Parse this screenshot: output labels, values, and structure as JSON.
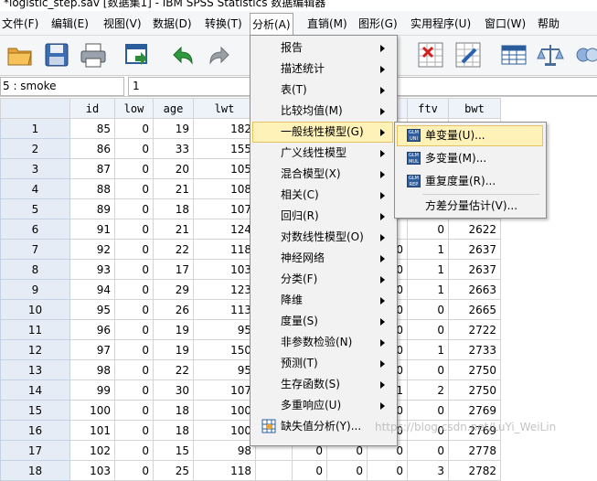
{
  "window": {
    "title": "*logistic_step.sav [数据集1] - IBM SPSS Statistics 数据编辑器"
  },
  "menubar": {
    "items": [
      {
        "label": "文件(F)"
      },
      {
        "label": "编辑(E)"
      },
      {
        "label": "视图(V)"
      },
      {
        "label": "数据(D)"
      },
      {
        "label": "转换(T)"
      },
      {
        "label": "分析(A)"
      },
      {
        "label": "直销(M)"
      },
      {
        "label": "图形(G)"
      },
      {
        "label": "实用程序(U)"
      },
      {
        "label": "窗口(W)"
      },
      {
        "label": "帮助"
      }
    ],
    "active_index": 5
  },
  "toolbar": {
    "icons": [
      "open-folder-icon",
      "save-icon",
      "print-icon",
      "dialog-recall-icon",
      "undo-icon",
      "redo-icon",
      "split-file-icon",
      "select-cases-icon",
      "value-labels-icon",
      "weight-cases-icon"
    ]
  },
  "cell_editor": {
    "reference": "5 : smoke",
    "value": "1"
  },
  "grid": {
    "columns": [
      "id",
      "low",
      "age",
      "lwt",
      "",
      "",
      "ht",
      "ui",
      "ftv",
      "bwt"
    ],
    "rows": [
      {
        "n": "1",
        "cells": [
          "85",
          "0",
          "19",
          "182",
          "",
          "",
          "",
          "",
          "",
          "2523"
        ]
      },
      {
        "n": "2",
        "cells": [
          "86",
          "0",
          "33",
          "155",
          "",
          "",
          "",
          "",
          "",
          "2551"
        ]
      },
      {
        "n": "3",
        "cells": [
          "87",
          "0",
          "20",
          "105",
          "",
          "",
          "",
          "",
          "",
          "2557"
        ]
      },
      {
        "n": "4",
        "cells": [
          "88",
          "0",
          "21",
          "108",
          "",
          "",
          "",
          "",
          "",
          "2594"
        ]
      },
      {
        "n": "5",
        "cells": [
          "89",
          "0",
          "18",
          "107",
          "",
          "",
          "",
          "",
          "",
          "2600"
        ]
      },
      {
        "n": "6",
        "cells": [
          "91",
          "0",
          "21",
          "124",
          "",
          "",
          "",
          "",
          "0",
          "2622"
        ]
      },
      {
        "n": "7",
        "cells": [
          "92",
          "0",
          "22",
          "118",
          "",
          "0",
          "0",
          "0",
          "1",
          "2637"
        ]
      },
      {
        "n": "8",
        "cells": [
          "93",
          "0",
          "17",
          "103",
          "",
          "0",
          "0",
          "0",
          "1",
          "2637"
        ]
      },
      {
        "n": "9",
        "cells": [
          "94",
          "0",
          "29",
          "123",
          "",
          "0",
          "0",
          "0",
          "1",
          "2663"
        ]
      },
      {
        "n": "10",
        "cells": [
          "95",
          "0",
          "26",
          "113",
          "",
          "0",
          "0",
          "0",
          "0",
          "2665"
        ]
      },
      {
        "n": "11",
        "cells": [
          "96",
          "0",
          "19",
          "95",
          "",
          "0",
          "0",
          "0",
          "0",
          "2722"
        ]
      },
      {
        "n": "12",
        "cells": [
          "97",
          "0",
          "19",
          "150",
          "",
          "0",
          "0",
          "0",
          "1",
          "2733"
        ]
      },
      {
        "n": "13",
        "cells": [
          "98",
          "0",
          "22",
          "95",
          "",
          "0",
          "1",
          "0",
          "0",
          "2750"
        ]
      },
      {
        "n": "14",
        "cells": [
          "99",
          "0",
          "30",
          "107",
          "",
          "1",
          "0",
          "1",
          "2",
          "2750"
        ]
      },
      {
        "n": "15",
        "cells": [
          "100",
          "0",
          "18",
          "100",
          "",
          "0",
          "0",
          "0",
          "0",
          "2769"
        ]
      },
      {
        "n": "16",
        "cells": [
          "101",
          "0",
          "18",
          "100",
          "",
          "0",
          "0",
          "0",
          "0",
          "2769"
        ]
      },
      {
        "n": "17",
        "cells": [
          "102",
          "0",
          "15",
          "98",
          "",
          "0",
          "0",
          "0",
          "0",
          "2778"
        ]
      },
      {
        "n": "18",
        "cells": [
          "103",
          "0",
          "25",
          "118",
          "",
          "0",
          "0",
          "0",
          "3",
          "2782"
        ]
      }
    ]
  },
  "analyze_menu": {
    "items": [
      {
        "label": "报告",
        "submenu": true
      },
      {
        "label": "描述统计",
        "submenu": true
      },
      {
        "label": "表(T)",
        "submenu": true
      },
      {
        "label": "比较均值(M)",
        "submenu": true
      },
      {
        "label": "一般线性模型(G)",
        "submenu": true,
        "highlighted": true
      },
      {
        "label": "广义线性模型",
        "submenu": true
      },
      {
        "label": "混合模型(X)",
        "submenu": true
      },
      {
        "label": "相关(C)",
        "submenu": true
      },
      {
        "label": "回归(R)",
        "submenu": true
      },
      {
        "label": "对数线性模型(O)",
        "submenu": true
      },
      {
        "label": "神经网络",
        "submenu": true
      },
      {
        "label": "分类(F)",
        "submenu": true
      },
      {
        "label": "降维",
        "submenu": true
      },
      {
        "label": "度量(S)",
        "submenu": true
      },
      {
        "label": "非参数检验(N)",
        "submenu": true
      },
      {
        "label": "预测(T)",
        "submenu": true
      },
      {
        "label": "生存函数(S)",
        "submenu": true
      },
      {
        "label": "多重响应(U)",
        "submenu": true
      },
      {
        "label": "缺失值分析(Y)...",
        "submenu": false,
        "icon": "missing-values-icon"
      }
    ]
  },
  "glm_submenu": {
    "items": [
      {
        "label": "单变量(U)...",
        "icon_text": "GLM UNI",
        "highlighted": true
      },
      {
        "label": "多变量(M)...",
        "icon_text": "GLM MUL"
      },
      {
        "label": "重复度量(R)...",
        "icon_text": "GLM REP"
      },
      {
        "label": "方差分量估计(V)...",
        "icon_text": ""
      }
    ]
  },
  "watermark": "https://blog.csdn.net/LuYi_WeiLin"
}
